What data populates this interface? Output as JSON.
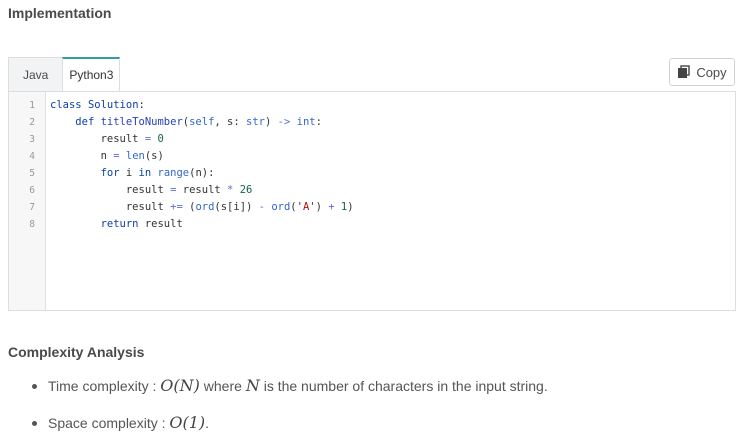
{
  "section_title": "Implementation",
  "tabs": [
    {
      "label": "Java"
    },
    {
      "label": "Python3"
    }
  ],
  "copy_button": {
    "label": "Copy",
    "icon": "copy-icon"
  },
  "code_lines": [
    {
      "n": "1"
    },
    {
      "n": "2"
    },
    {
      "n": "3"
    },
    {
      "n": "4"
    },
    {
      "n": "5"
    },
    {
      "n": "6"
    },
    {
      "n": "7"
    },
    {
      "n": "8"
    }
  ],
  "code_tokens": {
    "l1": [
      "class",
      "Solution",
      ":"
    ],
    "l2": [
      "def",
      "titleToNumber",
      "(",
      "self",
      ", s:",
      "str",
      ")",
      "->",
      "int",
      ":"
    ],
    "l3": [
      "result",
      "=",
      "0"
    ],
    "l4": [
      "n",
      "=",
      "len",
      "(s)"
    ],
    "l5": [
      "for",
      "i",
      "in",
      "range",
      "(n):"
    ],
    "l6": [
      "result",
      "=",
      "result",
      "*",
      "26"
    ],
    "l7": [
      "result",
      "+=",
      "(",
      "ord",
      "(s[i])",
      "-",
      "ord",
      "('",
      "A",
      "')",
      "+",
      "1",
      ")"
    ],
    "l8": [
      "return",
      "result"
    ]
  },
  "complexity": {
    "title": "Complexity Analysis",
    "time": {
      "label": "Time complexity :",
      "expr": "O(N)",
      "mid": "where",
      "var": "N",
      "rest": "is the number of characters in the input string."
    },
    "space": {
      "label": "Space complexity :",
      "expr": "O(1)",
      "rest": "."
    }
  }
}
